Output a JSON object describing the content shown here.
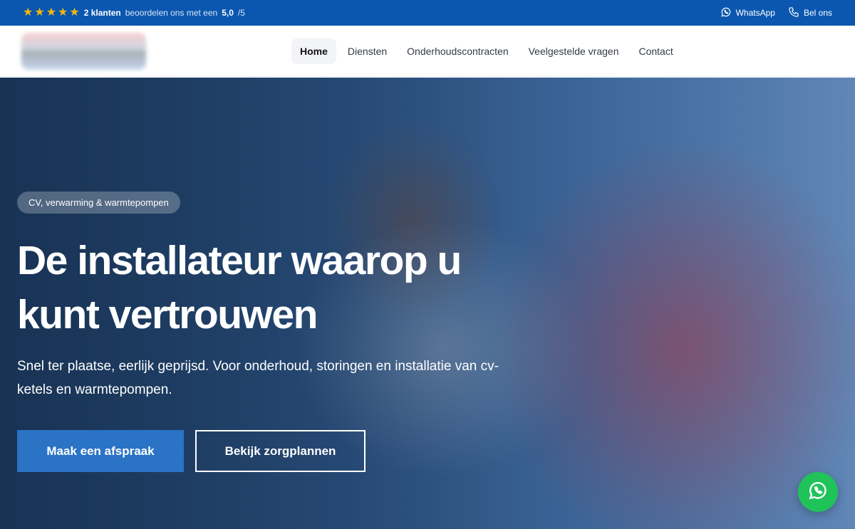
{
  "topbar": {
    "stars": [
      "★",
      "★",
      "★",
      "★",
      "★"
    ],
    "review_count": "2 klanten",
    "review_text": "beoordelen ons met een",
    "score": "5,0",
    "score_max": "/5",
    "whatsapp_label": "WhatsApp",
    "call_label": "Bel ons",
    "icons": {
      "whatsapp": "whatsapp-icon",
      "call": "phone-icon"
    },
    "colors": {
      "bg": "#0b57b0",
      "star": "#f5b80a"
    }
  },
  "nav": {
    "items": [
      {
        "label": "Home",
        "active": true
      },
      {
        "label": "Diensten"
      },
      {
        "label": "Onderhoudscontracten"
      },
      {
        "label": "Veelgestelde vragen"
      },
      {
        "label": "Contact"
      }
    ]
  },
  "hero": {
    "pill": "CV, verwarming & warmtepompen",
    "headline": "De installateur waarop u kunt vertrouwen",
    "subtitle": "Snel ter plaatse, eerlijk geprijsd. Voor onderhoud, storingen en installatie van cv-ketels en warmtepompen.",
    "primary_cta": "Maak een afspraak",
    "secondary_cta": "Bekijk zorgplannen",
    "colors": {
      "primary": "#2a73c5"
    }
  },
  "floating": {
    "icon": "whatsapp-icon",
    "color": "#1fc35a"
  }
}
